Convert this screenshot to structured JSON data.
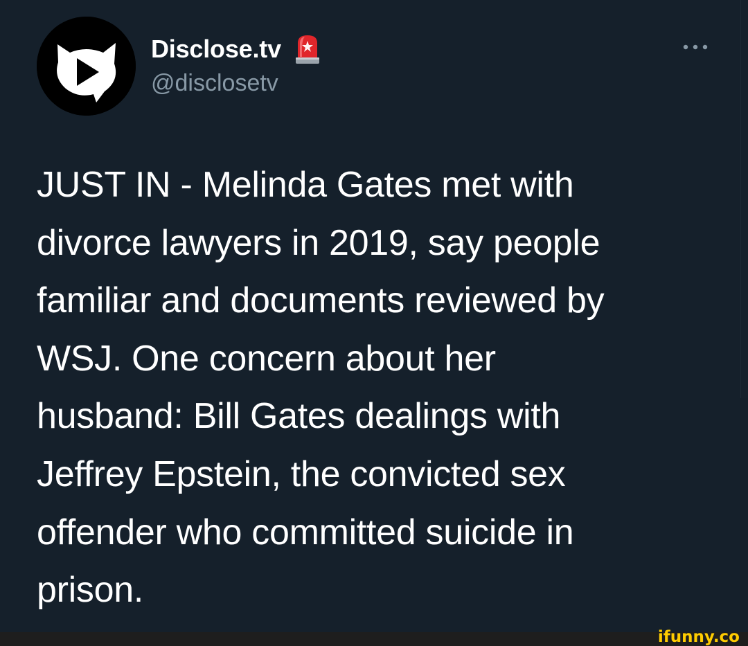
{
  "tweet": {
    "author_name": "Disclose.tv",
    "author_handle": "@disclosetv",
    "text": "JUST IN - Melinda Gates met with\ndivorce lawyers in 2019, say people\nfamiliar and documents reviewed by\nWSJ. One concern about her\nhusband: Bill Gates dealings with\nJeffrey Epstein, the convicted sex\noffender who committed suicide in\nprison."
  },
  "icons": {
    "avatar": "play-speech-bubble-logo",
    "badge": "police-siren-icon",
    "more": "more-dots-icon"
  },
  "colors": {
    "background": "#15202b",
    "text": "#ffffff",
    "secondary_text": "#8899a6",
    "watermark": "#ffcc00"
  },
  "watermark": {
    "text": "ifunny.co"
  }
}
